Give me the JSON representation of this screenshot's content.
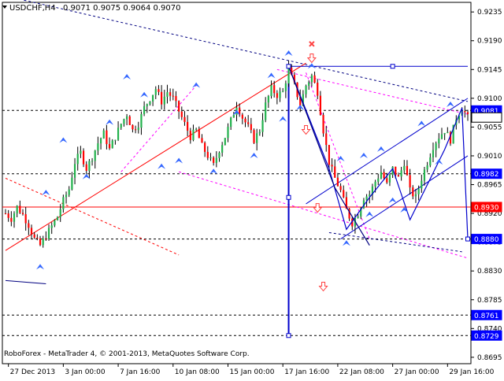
{
  "header": {
    "symbol": "USDCHF,H4",
    "ohlc": "0.9071 0.9075 0.9064 0.9070"
  },
  "footer": {
    "copyright": "RoboForex - MetaTrader 4, © 2001-2013, MetaQuotes Software Corp."
  },
  "colors": {
    "bull": "#22b14c",
    "bear": "#ff0000",
    "wick": "#000000",
    "trend_red": "#ff0000",
    "trend_magenta": "#ff00ff",
    "channel_blue": "#0000cc",
    "wave_navy": "#000080",
    "arrow_blue": "#3366ff",
    "arrow_red": "#ff4040",
    "tag_blue": "#0000ff",
    "tag_red": "#ff0000"
  },
  "chart_data": {
    "type": "candlestick",
    "ylim": [
      0.8685,
      0.925
    ],
    "y_ticks": [
      "0.9235",
      "0.9190",
      "0.9145",
      "0.9100",
      "0.9055",
      "0.9010",
      "0.8965",
      "0.8920",
      "0.8875",
      "0.8830",
      "0.8785",
      "0.8740",
      "0.8695"
    ],
    "x_ticks": [
      "27 Dec 2013",
      "3 Jan 00:00",
      "7 Jan 16:00",
      "10 Jan 08:00",
      "15 Jan 00:00",
      "17 Jan 16:00",
      "22 Jan 08:00",
      "27 Jan 00:00",
      "29 Jan 16:00"
    ],
    "price_tags": [
      {
        "value": 0.9081,
        "label": "0.9081",
        "color": "blue"
      },
      {
        "value": 0.907,
        "label": "0.9070",
        "color": "white"
      },
      {
        "value": 0.8982,
        "label": "0.8982",
        "color": "blue"
      },
      {
        "value": 0.893,
        "label": "0.8930",
        "color": "red"
      },
      {
        "value": 0.888,
        "label": "0.8880",
        "color": "blue"
      },
      {
        "value": 0.8761,
        "label": "0.8761",
        "color": "blue"
      },
      {
        "value": 0.8729,
        "label": "0.8729",
        "color": "blue"
      }
    ],
    "levels": [
      {
        "value": 0.9081,
        "style": "dashed",
        "color": "#000000"
      },
      {
        "value": 0.8982,
        "style": "dashed",
        "color": "#000000"
      },
      {
        "value": 0.893,
        "style": "solid",
        "color": "#ff0000"
      },
      {
        "value": 0.888,
        "style": "dashed",
        "color": "#000000"
      },
      {
        "value": 0.8761,
        "style": "dashed",
        "color": "#000000"
      },
      {
        "value": 0.8729,
        "style": "dashed",
        "color": "#000000"
      }
    ],
    "close_path": [
      [
        0,
        0.892
      ],
      [
        2,
        0.8912
      ],
      [
        4,
        0.893
      ],
      [
        6,
        0.8918
      ],
      [
        8,
        0.8902
      ],
      [
        10,
        0.888
      ],
      [
        12,
        0.887
      ],
      [
        14,
        0.8885
      ],
      [
        16,
        0.89
      ],
      [
        18,
        0.8915
      ],
      [
        20,
        0.894
      ],
      [
        22,
        0.8958
      ],
      [
        24,
        0.9
      ],
      [
        26,
        0.9015
      ],
      [
        28,
        0.899
      ],
      [
        30,
        0.9008
      ],
      [
        32,
        0.903
      ],
      [
        34,
        0.9045
      ],
      [
        36,
        0.902
      ],
      [
        38,
        0.904
      ],
      [
        40,
        0.906
      ],
      [
        42,
        0.9075
      ],
      [
        44,
        0.905
      ],
      [
        46,
        0.906
      ],
      [
        48,
        0.9085
      ],
      [
        50,
        0.91
      ],
      [
        52,
        0.9115
      ],
      [
        54,
        0.9095
      ],
      [
        56,
        0.911
      ],
      [
        58,
        0.91
      ],
      [
        60,
        0.908
      ],
      [
        62,
        0.906
      ],
      [
        64,
        0.904
      ],
      [
        66,
        0.905
      ],
      [
        68,
        0.9025
      ],
      [
        70,
        0.901
      ],
      [
        72,
        0.8995
      ],
      [
        74,
        0.902
      ],
      [
        76,
        0.904
      ],
      [
        78,
        0.9065
      ],
      [
        80,
        0.909
      ],
      [
        82,
        0.907
      ],
      [
        84,
        0.9055
      ],
      [
        86,
        0.9035
      ],
      [
        88,
        0.905
      ],
      [
        90,
        0.909
      ],
      [
        92,
        0.9115
      ],
      [
        94,
        0.9105
      ],
      [
        96,
        0.911
      ],
      [
        98,
        0.9145
      ],
      [
        100,
        0.912
      ],
      [
        102,
        0.909
      ],
      [
        104,
        0.912
      ],
      [
        106,
        0.9135
      ],
      [
        108,
        0.911
      ],
      [
        110,
        0.905
      ],
      [
        112,
        0.9
      ],
      [
        114,
        0.8975
      ],
      [
        116,
        0.8955
      ],
      [
        118,
        0.8925
      ],
      [
        120,
        0.8905
      ],
      [
        122,
        0.892
      ],
      [
        124,
        0.8945
      ],
      [
        126,
        0.895
      ],
      [
        128,
        0.897
      ],
      [
        130,
        0.8985
      ],
      [
        132,
        0.8965
      ],
      [
        134,
        0.899
      ],
      [
        136,
        0.8975
      ],
      [
        138,
        0.9
      ],
      [
        140,
        0.8955
      ],
      [
        142,
        0.8945
      ],
      [
        144,
        0.8975
      ],
      [
        146,
        0.9
      ],
      [
        148,
        0.9025
      ],
      [
        150,
        0.904
      ],
      [
        152,
        0.905
      ],
      [
        154,
        0.9035
      ],
      [
        156,
        0.907
      ],
      [
        158,
        0.9085
      ],
      [
        160,
        0.907
      ]
    ],
    "bars": 161,
    "trendlines": [
      {
        "name": "red-support",
        "color": "#ff0000",
        "style": "solid",
        "from": [
          0,
          0.8862
        ],
        "to": [
          104,
          0.9155
        ]
      },
      {
        "name": "red-dotted",
        "color": "#ff0000",
        "style": "dotted",
        "from": [
          0,
          0.8975
        ],
        "to": [
          60,
          0.8855
        ]
      },
      {
        "name": "magenta-dotted-a",
        "color": "#ff00ff",
        "style": "dotted",
        "from": [
          60,
          0.8985
        ],
        "to": [
          160,
          0.885
        ]
      },
      {
        "name": "magenta-dotted-b",
        "color": "#ff00ff",
        "style": "dotted",
        "from": [
          40,
          0.8985
        ],
        "to": [
          66,
          0.912
        ]
      },
      {
        "name": "magenta-dotted-c",
        "color": "#ff00ff",
        "style": "dotted",
        "from": [
          94,
          0.9145
        ],
        "to": [
          160,
          0.9075
        ]
      },
      {
        "name": "magenta-dotted-d",
        "color": "#ff00ff",
        "style": "dotted",
        "from": [
          104,
          0.914
        ],
        "to": [
          126,
          0.888
        ]
      },
      {
        "name": "navy-dotted-top",
        "color": "#000080",
        "style": "dotted",
        "from": [
          0,
          0.926
        ],
        "to": [
          160,
          0.9095
        ]
      },
      {
        "name": "navy-dotted-bottom",
        "color": "#000080",
        "style": "dotted",
        "from": [
          112,
          0.889
        ],
        "to": [
          158,
          0.886
        ]
      },
      {
        "name": "blue-channel-top",
        "color": "#0000cc",
        "style": "solid",
        "from": [
          104,
          0.8935
        ],
        "to": [
          160,
          0.91
        ]
      },
      {
        "name": "blue-channel-bot",
        "color": "#0000cc",
        "style": "solid",
        "from": [
          116,
          0.888
        ],
        "to": [
          160,
          0.901
        ]
      },
      {
        "name": "blue-resistance",
        "color": "#0000cc",
        "style": "solid",
        "from": [
          98,
          0.915
        ],
        "to": [
          160,
          0.915
        ]
      },
      {
        "name": "blue-vertical",
        "color": "#0000cc",
        "style": "solid",
        "from": [
          98,
          0.915
        ],
        "to": [
          98,
          0.8729
        ]
      },
      {
        "name": "navy-small",
        "color": "#000080",
        "style": "solid",
        "from": [
          0,
          0.8815
        ],
        "to": [
          14,
          0.881
        ]
      }
    ],
    "wave_paths": [
      {
        "color": "#0000cc",
        "points": [
          [
            98,
            0.915
          ],
          [
            112,
            0.899
          ],
          [
            118,
            0.8895
          ],
          [
            126,
            0.8945
          ],
          [
            134,
            0.899
          ],
          [
            140,
            0.891
          ],
          [
            152,
            0.902
          ],
          [
            158,
            0.9085
          ],
          [
            160,
            0.888
          ]
        ]
      },
      {
        "color": "#000080",
        "points": [
          [
            98,
            0.915
          ],
          [
            114,
            0.896
          ],
          [
            126,
            0.887
          ]
        ]
      }
    ],
    "blue_arrows": [
      [
        14,
        0.8952
      ],
      [
        12,
        0.8836
      ],
      [
        20,
        0.9034
      ],
      [
        28,
        0.8977
      ],
      [
        36,
        0.9062
      ],
      [
        42,
        0.9133
      ],
      [
        48,
        0.9105
      ],
      [
        54,
        0.8993
      ],
      [
        60,
        0.9002
      ],
      [
        66,
        0.912
      ],
      [
        72,
        0.8985
      ],
      [
        80,
        0.9077
      ],
      [
        86,
        0.901
      ],
      [
        92,
        0.9135
      ],
      [
        96,
        0.9067
      ],
      [
        98,
        0.917
      ],
      [
        102,
        0.9085
      ],
      [
        106,
        0.915
      ],
      [
        116,
        0.9005
      ],
      [
        118,
        0.8873
      ],
      [
        124,
        0.901
      ],
      [
        126,
        0.8918
      ],
      [
        130,
        0.902
      ],
      [
        134,
        0.894
      ],
      [
        138,
        0.8925
      ],
      [
        144,
        0.906
      ],
      [
        150,
        0.9
      ],
      [
        154,
        0.909
      ]
    ],
    "red_arrows": [
      [
        106,
        0.9162
      ],
      [
        104,
        0.905
      ],
      [
        108,
        0.8928
      ],
      [
        110,
        0.8805
      ]
    ],
    "cross_marker": [
      106,
      0.9185
    ],
    "markers_square": [
      [
        98,
        0.915
      ],
      [
        134,
        0.915
      ],
      [
        98,
        0.8945
      ],
      [
        98,
        0.8729
      ],
      [
        160,
        0.888
      ]
    ]
  }
}
